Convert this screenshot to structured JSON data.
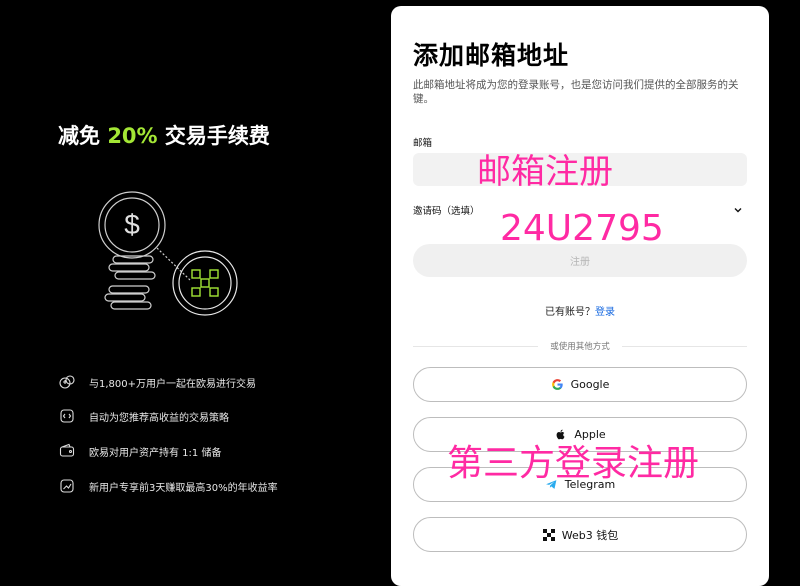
{
  "promo": {
    "title_prefix": "减免 ",
    "title_accent": "20%",
    "title_suffix": " 交易手续费",
    "accent_color": "#a3e635",
    "features": [
      {
        "icon": "users-exchange-icon",
        "label": "与1,800+万用户一起在欧易进行交易"
      },
      {
        "icon": "strategy-icon",
        "label": "自动为您推荐高收益的交易策略"
      },
      {
        "icon": "wallet-icon",
        "label": "欧易对用户资产持有 1:1 储备"
      },
      {
        "icon": "chart-growth-icon",
        "label": "新用户专享前3天赚取最高30%的年收益率"
      }
    ]
  },
  "form": {
    "title": "添加邮箱地址",
    "subtitle": "此邮箱地址将成为您的登录账号，也是您访问我们提供的全部服务的关键。",
    "email_label": "邮箱",
    "email_value": "",
    "invite_label": "邀请码（选填）",
    "register_label": "注册",
    "login_prompt": "已有账号？",
    "login_link": "登录",
    "divider_text": "或使用其他方式",
    "sso": [
      {
        "icon": "google-icon",
        "label": "Google"
      },
      {
        "icon": "apple-icon",
        "label": "Apple"
      },
      {
        "icon": "telegram-icon",
        "label": "Telegram"
      },
      {
        "icon": "web3-icon",
        "label": "Web3 钱包"
      }
    ]
  },
  "overlays": {
    "email_register": "邮箱注册",
    "invite_code": "24U2795",
    "third_party": "第三方登录注册",
    "color": "#ff2aa3"
  }
}
